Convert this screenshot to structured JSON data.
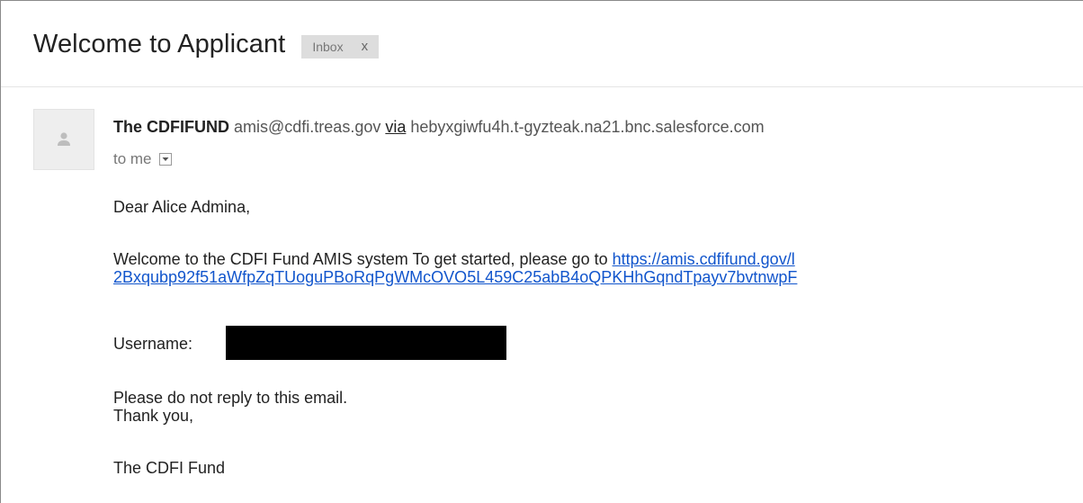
{
  "email": {
    "subject": "Welcome to Applicant",
    "label_chip": {
      "text": "Inbox",
      "remove": "x"
    },
    "sender": {
      "name": "The CDFIFUND",
      "email": "amis@cdfi.treas.gov",
      "via_label": "via",
      "via_domain": "hebyxgiwfu4h.t-gyzteak.na21.bnc.salesforce.com",
      "avatar_icon": "person-icon"
    },
    "recipient": {
      "text": "to me",
      "dropdown_icon": "dropdown-arrow-icon"
    },
    "body": {
      "greeting": "Dear Alice Admina,",
      "welcome_text": "Welcome to the CDFI Fund AMIS system To get started, please go to ",
      "link_line1": "https://amis.cdfifund.gov/l",
      "link_line2": "2Bxqubp92f51aWfpZqTUoguPBoRqPgWMcOVO5L459C25abB4oQPKHhGqndTpayv7bvtnwpF",
      "username_label": "Username:",
      "noreply": "Please do not reply to this email.",
      "thanks": "Thank you,",
      "signature": "The CDFI Fund"
    }
  },
  "colors": {
    "link": "#1155cc",
    "chip_bg": "#dddddd",
    "redaction": "#000000"
  }
}
